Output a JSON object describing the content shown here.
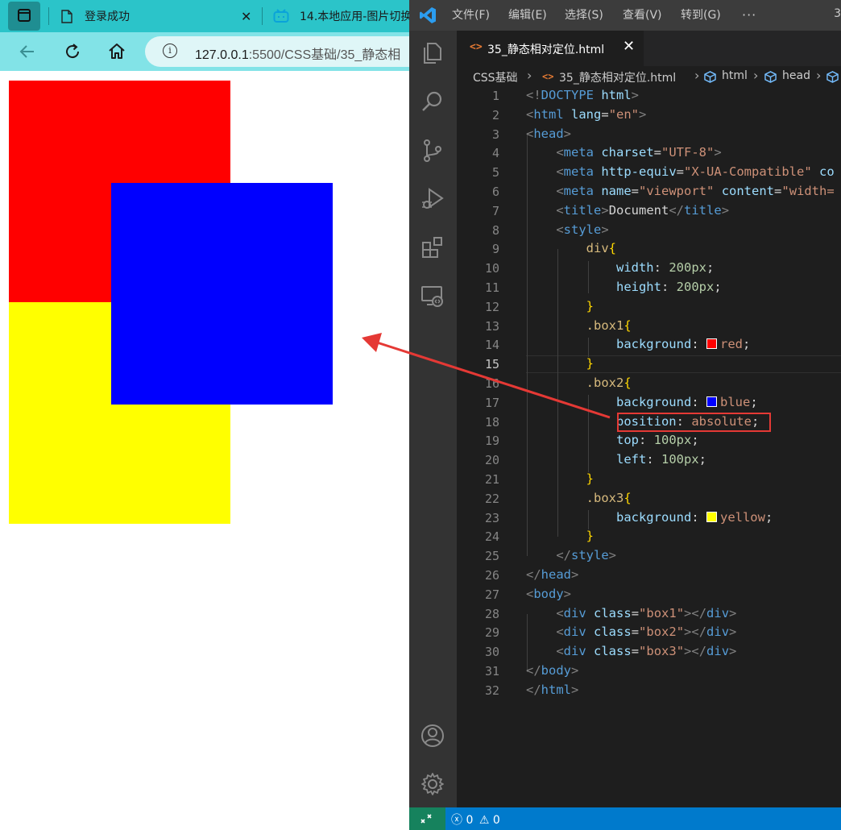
{
  "browser": {
    "tabs": [
      {
        "title": "登录成功",
        "close": "✕"
      },
      {
        "title": "14.本地应用-图片切换"
      }
    ],
    "address": {
      "info": "i",
      "host": "127.0.0.1",
      "path": ":5500/CSS基础/35_静态相"
    }
  },
  "vscode": {
    "menu": [
      "文件(F)",
      "编辑(E)",
      "选择(S)",
      "查看(V)",
      "转到(G)",
      "···"
    ],
    "title_right": "3",
    "tab": {
      "name": "35_静态相对定位.html",
      "close": "✕",
      "icon": "<>"
    },
    "breadcrumb": [
      "CSS基础",
      "35_静态相对定位.html",
      "html",
      "head"
    ],
    "status": {
      "errors": "0",
      "warnings": "0"
    },
    "active_line": 15
  },
  "code_lines": [
    {
      "n": "1",
      "html": "<span class=\"t-br\">&lt;!</span><span class=\"t-tag\">DOCTYPE</span> <span class=\"t-attr\">html</span><span class=\"t-br\">&gt;</span>"
    },
    {
      "n": "2",
      "html": "<span class=\"t-br\">&lt;</span><span class=\"t-tag\">html</span> <span class=\"t-attr\">lang</span><span class=\"t-txt\">=</span><span class=\"t-str\">\"en\"</span><span class=\"t-br\">&gt;</span>"
    },
    {
      "n": "3",
      "html": "<span class=\"t-br\">&lt;</span><span class=\"t-tag\">head</span><span class=\"t-br\">&gt;</span>"
    },
    {
      "n": "4",
      "html": "    <span class=\"t-br\">&lt;</span><span class=\"t-tag\">meta</span> <span class=\"t-attr\">charset</span><span class=\"t-txt\">=</span><span class=\"t-str\">\"UTF-8\"</span><span class=\"t-br\">&gt;</span>"
    },
    {
      "n": "5",
      "html": "    <span class=\"t-br\">&lt;</span><span class=\"t-tag\">meta</span> <span class=\"t-attr\">http-equiv</span><span class=\"t-txt\">=</span><span class=\"t-str\">\"X-UA-Compatible\"</span> <span class=\"t-attr\">co</span>"
    },
    {
      "n": "6",
      "html": "    <span class=\"t-br\">&lt;</span><span class=\"t-tag\">meta</span> <span class=\"t-attr\">name</span><span class=\"t-txt\">=</span><span class=\"t-str\">\"viewport\"</span> <span class=\"t-attr\">content</span><span class=\"t-txt\">=</span><span class=\"t-str\">\"width=</span>"
    },
    {
      "n": "7",
      "html": "    <span class=\"t-br\">&lt;</span><span class=\"t-tag\">title</span><span class=\"t-br\">&gt;</span><span class=\"t-txt\">Document</span><span class=\"t-br\">&lt;/</span><span class=\"t-tag\">title</span><span class=\"t-br\">&gt;</span>"
    },
    {
      "n": "8",
      "html": "    <span class=\"t-br\">&lt;</span><span class=\"t-tag\">style</span><span class=\"t-br\">&gt;</span>"
    },
    {
      "n": "9",
      "html": "        <span class=\"t-sel\">div</span><span class=\"t-brace\">{</span>"
    },
    {
      "n": "10",
      "html": "            <span class=\"t-prop\">width</span><span class=\"t-txt\">: </span><span class=\"t-num\">200px</span><span class=\"t-txt\">;</span>"
    },
    {
      "n": "11",
      "html": "            <span class=\"t-prop\">height</span><span class=\"t-txt\">: </span><span class=\"t-num\">200px</span><span class=\"t-txt\">;</span>"
    },
    {
      "n": "12",
      "html": "        <span class=\"t-brace\">}</span>"
    },
    {
      "n": "13",
      "html": "        <span class=\"t-sel\">.box1</span><span class=\"t-brace\">{</span>"
    },
    {
      "n": "14",
      "html": "            <span class=\"t-prop\">background</span><span class=\"t-txt\">: </span><span class=\"swatch\" style=\"background:#ff0000\"></span><span class=\"t-val\">red</span><span class=\"t-txt\">;</span>"
    },
    {
      "n": "15",
      "html": "        <span class=\"t-brace\">}</span>"
    },
    {
      "n": "16",
      "html": "        <span class=\"t-sel\">.box2</span><span class=\"t-brace\">{</span>"
    },
    {
      "n": "17",
      "html": "            <span class=\"t-prop\">background</span><span class=\"t-txt\">: </span><span class=\"swatch\" style=\"background:#0000ff\"></span><span class=\"t-val\">blue</span><span class=\"t-txt\">;</span>"
    },
    {
      "n": "18",
      "html": "            <span class=\"t-prop\">position</span><span class=\"t-txt\">: </span><span class=\"t-val\">absolute</span><span class=\"t-txt\">;</span>"
    },
    {
      "n": "19",
      "html": "            <span class=\"t-prop\">top</span><span class=\"t-txt\">: </span><span class=\"t-num\">100px</span><span class=\"t-txt\">;</span>"
    },
    {
      "n": "20",
      "html": "            <span class=\"t-prop\">left</span><span class=\"t-txt\">: </span><span class=\"t-num\">100px</span><span class=\"t-txt\">;</span>"
    },
    {
      "n": "21",
      "html": "        <span class=\"t-brace\">}</span>"
    },
    {
      "n": "22",
      "html": "        <span class=\"t-sel\">.box3</span><span class=\"t-brace\">{</span>"
    },
    {
      "n": "23",
      "html": "            <span class=\"t-prop\">background</span><span class=\"t-txt\">: </span><span class=\"swatch\" style=\"background:#ffff00\"></span><span class=\"t-val\">yellow</span><span class=\"t-txt\">;</span>"
    },
    {
      "n": "24",
      "html": "        <span class=\"t-brace\">}</span>"
    },
    {
      "n": "25",
      "html": "    <span class=\"t-br\">&lt;/</span><span class=\"t-tag\">style</span><span class=\"t-br\">&gt;</span>"
    },
    {
      "n": "26",
      "html": "<span class=\"t-br\">&lt;/</span><span class=\"t-tag\">head</span><span class=\"t-br\">&gt;</span>"
    },
    {
      "n": "27",
      "html": "<span class=\"t-br\">&lt;</span><span class=\"t-tag\">body</span><span class=\"t-br\">&gt;</span>"
    },
    {
      "n": "28",
      "html": "    <span class=\"t-br\">&lt;</span><span class=\"t-tag\">div</span> <span class=\"t-attr\">class</span><span class=\"t-txt\">=</span><span class=\"t-str\">\"box1\"</span><span class=\"t-br\">&gt;&lt;/</span><span class=\"t-tag\">div</span><span class=\"t-br\">&gt;</span>"
    },
    {
      "n": "29",
      "html": "    <span class=\"t-br\">&lt;</span><span class=\"t-tag\">div</span> <span class=\"t-attr\">class</span><span class=\"t-txt\">=</span><span class=\"t-str\">\"box2\"</span><span class=\"t-br\">&gt;&lt;/</span><span class=\"t-tag\">div</span><span class=\"t-br\">&gt;</span>"
    },
    {
      "n": "30",
      "html": "    <span class=\"t-br\">&lt;</span><span class=\"t-tag\">div</span> <span class=\"t-attr\">class</span><span class=\"t-txt\">=</span><span class=\"t-str\">\"box3\"</span><span class=\"t-br\">&gt;&lt;/</span><span class=\"t-tag\">div</span><span class=\"t-br\">&gt;</span>"
    },
    {
      "n": "31",
      "html": "<span class=\"t-br\">&lt;/</span><span class=\"t-tag\">body</span><span class=\"t-br\">&gt;</span>"
    },
    {
      "n": "32",
      "html": "<span class=\"t-br\">&lt;/</span><span class=\"t-tag\">html</span><span class=\"t-br\">&gt;</span>"
    }
  ]
}
